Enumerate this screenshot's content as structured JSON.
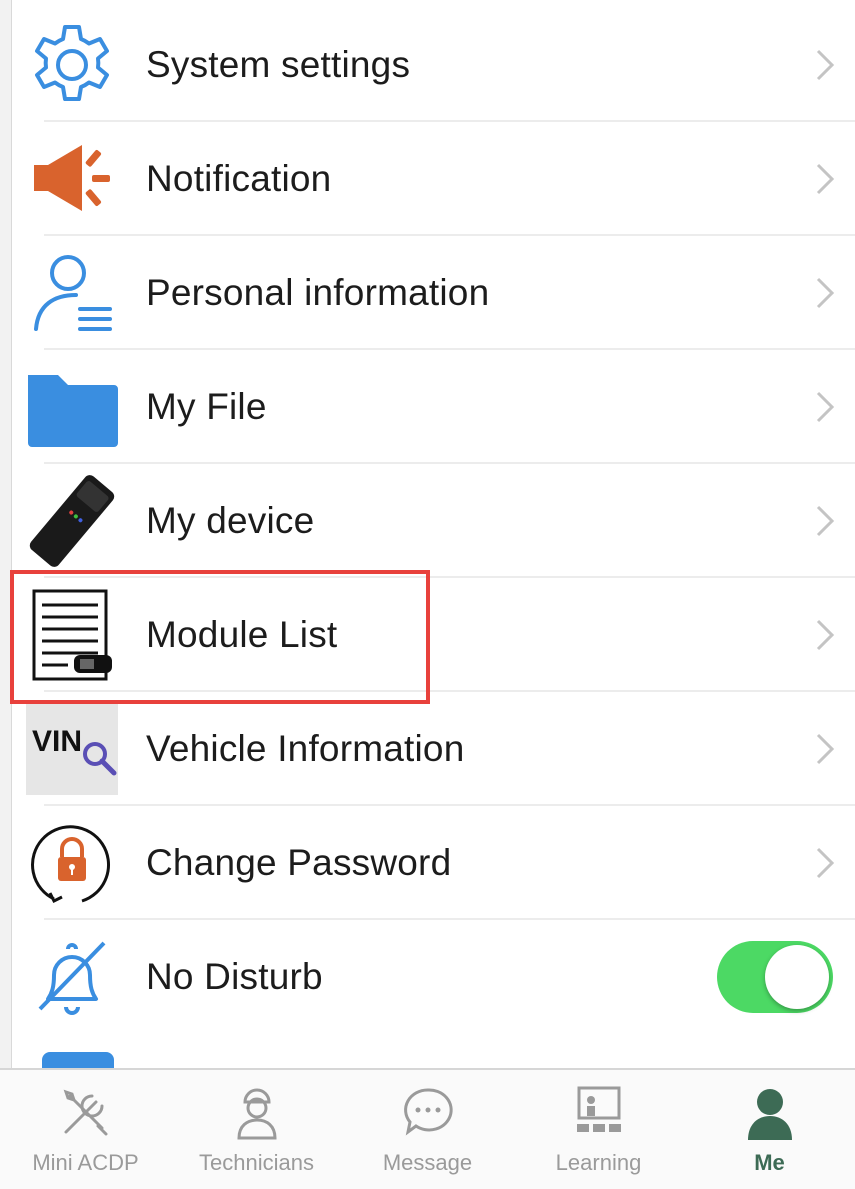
{
  "menu": {
    "items": [
      {
        "label": "System settings",
        "icon": "gear-icon"
      },
      {
        "label": "Notification",
        "icon": "megaphone-icon"
      },
      {
        "label": "Personal information",
        "icon": "user-profile-icon"
      },
      {
        "label": "My File",
        "icon": "folder-icon"
      },
      {
        "label": "My device",
        "icon": "device-icon"
      },
      {
        "label": "Module List",
        "icon": "document-list-icon"
      },
      {
        "label": "Vehicle Information",
        "icon": "vin-search-icon",
        "icon_text": "VIN"
      },
      {
        "label": "Change Password",
        "icon": "lock-refresh-icon"
      },
      {
        "label": "No Disturb",
        "icon": "bell-off-icon",
        "toggle_on": true
      }
    ],
    "highlighted_item": "Module List"
  },
  "tabbar": {
    "tabs": [
      {
        "label": "Mini ACDP",
        "icon": "tools-icon",
        "active": false
      },
      {
        "label": "Technicians",
        "icon": "technician-icon",
        "active": false
      },
      {
        "label": "Message",
        "icon": "chat-bubble-icon",
        "active": false
      },
      {
        "label": "Learning",
        "icon": "classroom-icon",
        "active": false
      },
      {
        "label": "Me",
        "icon": "person-icon",
        "active": true
      }
    ]
  },
  "colors": {
    "accent_blue": "#3a8ee0",
    "notification_orange": "#d9632d",
    "toggle_green": "#4cd964",
    "highlight_red": "#e8413c",
    "active_tab": "#3d6b55"
  }
}
